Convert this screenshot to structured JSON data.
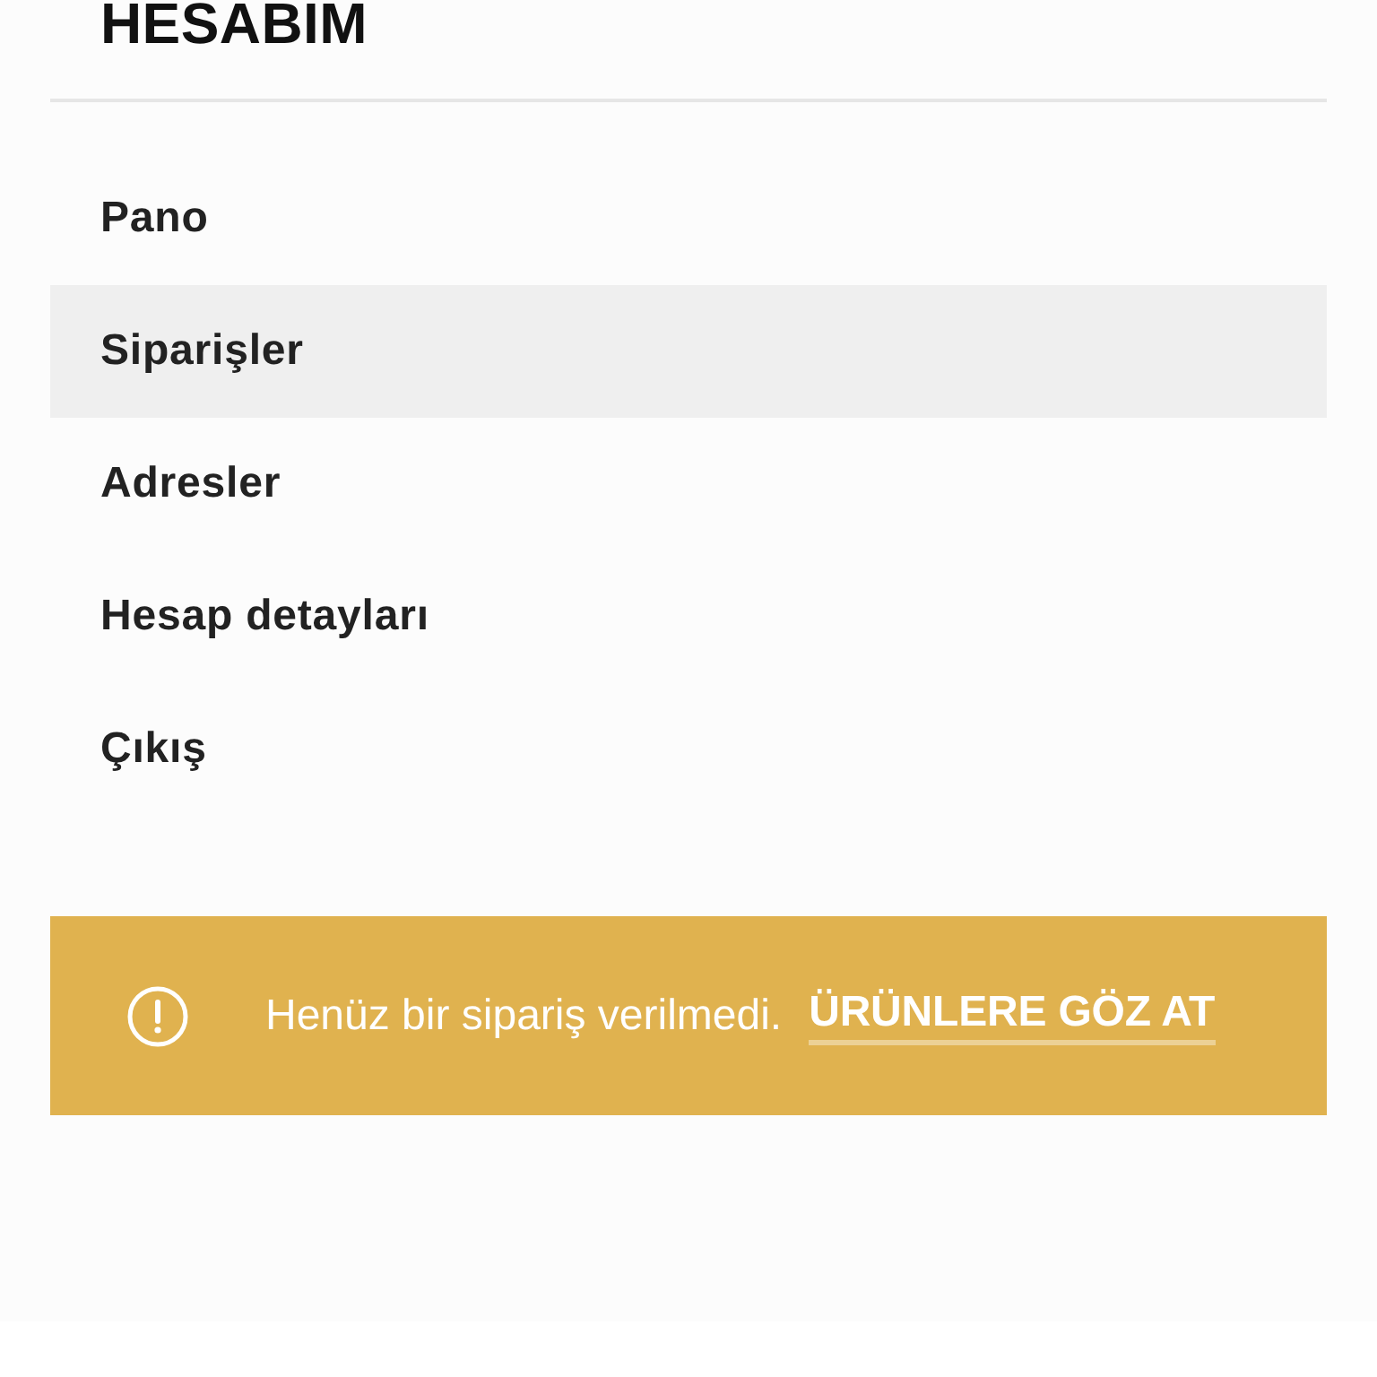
{
  "header": {
    "title": "HESABIM"
  },
  "menu": {
    "items": [
      {
        "label": "Pano",
        "selected": false
      },
      {
        "label": "Siparişler",
        "selected": true
      },
      {
        "label": "Adresler",
        "selected": false
      },
      {
        "label": "Hesap detayları",
        "selected": false
      },
      {
        "label": "Çıkış",
        "selected": false
      }
    ]
  },
  "notice": {
    "message": "Henüz bir sipariş verilmedi.",
    "link": "ÜRÜNLERE GÖZ AT"
  }
}
